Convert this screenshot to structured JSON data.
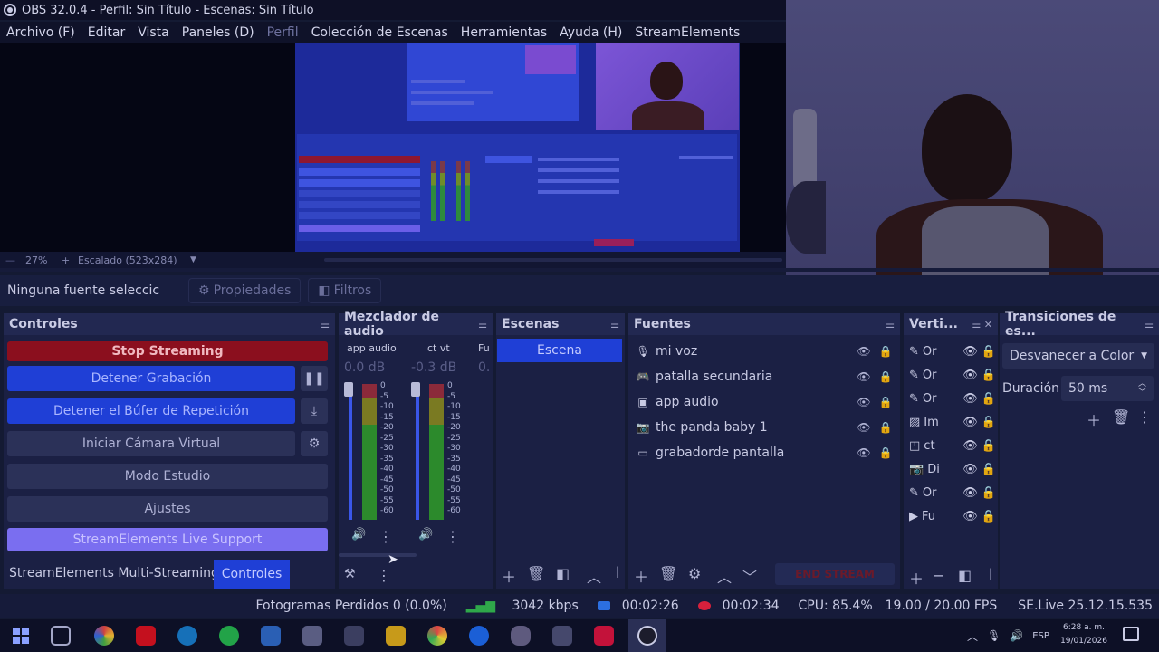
{
  "window": {
    "title": "OBS 32.0.4 - Perfil: Sin Título - Escenas: Sin Título"
  },
  "menu": [
    "Archivo (F)",
    "Editar",
    "Vista",
    "Paneles (D)",
    "Perfil",
    "Colección de Escenas",
    "Herramientas",
    "Ayuda (H)",
    "StreamElements"
  ],
  "zoom": {
    "percent": "27%",
    "scaling": "Escalado (523x284)"
  },
  "source_toolbar": {
    "selection": "Ninguna fuente seleccic",
    "properties": "Propiedades",
    "filters": "Filtros"
  },
  "docks": {
    "controls": {
      "title": "Controles",
      "stop_streaming": "Stop Streaming",
      "stop_recording": "Detener Grabación",
      "stop_replay": "Detener el Búfer de Repetición",
      "virtual_cam": "Iniciar Cámara Virtual",
      "studio_mode": "Modo Estudio",
      "settings": "Ajustes",
      "se_support": "StreamElements Live Support"
    },
    "mixer": {
      "title": "Mezclador de audio",
      "channels": [
        {
          "name": "app audio",
          "db": "0.0 dB"
        },
        {
          "name": "ct vt",
          "db": "-0.3 dB"
        },
        {
          "name": "Fu",
          "db": "0."
        }
      ],
      "ticks": [
        "0",
        "-5",
        "-10",
        "-15",
        "-20",
        "-25",
        "-30",
        "-35",
        "-40",
        "-45",
        "-50",
        "-55",
        "-60"
      ]
    },
    "scenes": {
      "title": "Escenas",
      "items": [
        "Escena"
      ]
    },
    "sources": {
      "title": "Fuentes",
      "items": [
        {
          "icon": "mic-icon",
          "label": "mi voz"
        },
        {
          "icon": "gamepad-icon",
          "label": "patalla secundaria"
        },
        {
          "icon": "app-window-icon",
          "label": "app audio"
        },
        {
          "icon": "camera-icon",
          "label": "the panda baby 1"
        },
        {
          "icon": "display-icon",
          "label": "grabadorde pantalla"
        }
      ],
      "end_stream": "END STREAM"
    },
    "vertical": {
      "title": "Verti...",
      "items": [
        "Or",
        "Or",
        "Or",
        "Im",
        "ct",
        "Di",
        "Or",
        "Fu"
      ]
    },
    "transitions": {
      "title": "Transiciones de es...",
      "selected": "Desvanecer a Color",
      "duration_label": "Duración",
      "duration_value": "50 ms"
    }
  },
  "dock_tabs": [
    "StreamElements Multi-Streaming",
    "Controles"
  ],
  "status": {
    "dropped_frames": "Fotogramas Perdidos 0 (0.0%)",
    "bitrate": "3042 kbps",
    "stream_time": "00:02:26",
    "record_time": "00:02:34",
    "cpu": "CPU: 85.4%",
    "fps": "19.00 / 20.00 FPS",
    "se_version": "SE.Live 25.12.15.535"
  },
  "taskbar": {
    "language": "ESP",
    "time": "6:28 a. m.",
    "date": "19/01/2026"
  },
  "colors": {
    "accent_blue": "#1f3fd6",
    "stop_red": "#8b0f1e",
    "lavender": "#7a6ef0",
    "panel": "#1b2044"
  }
}
